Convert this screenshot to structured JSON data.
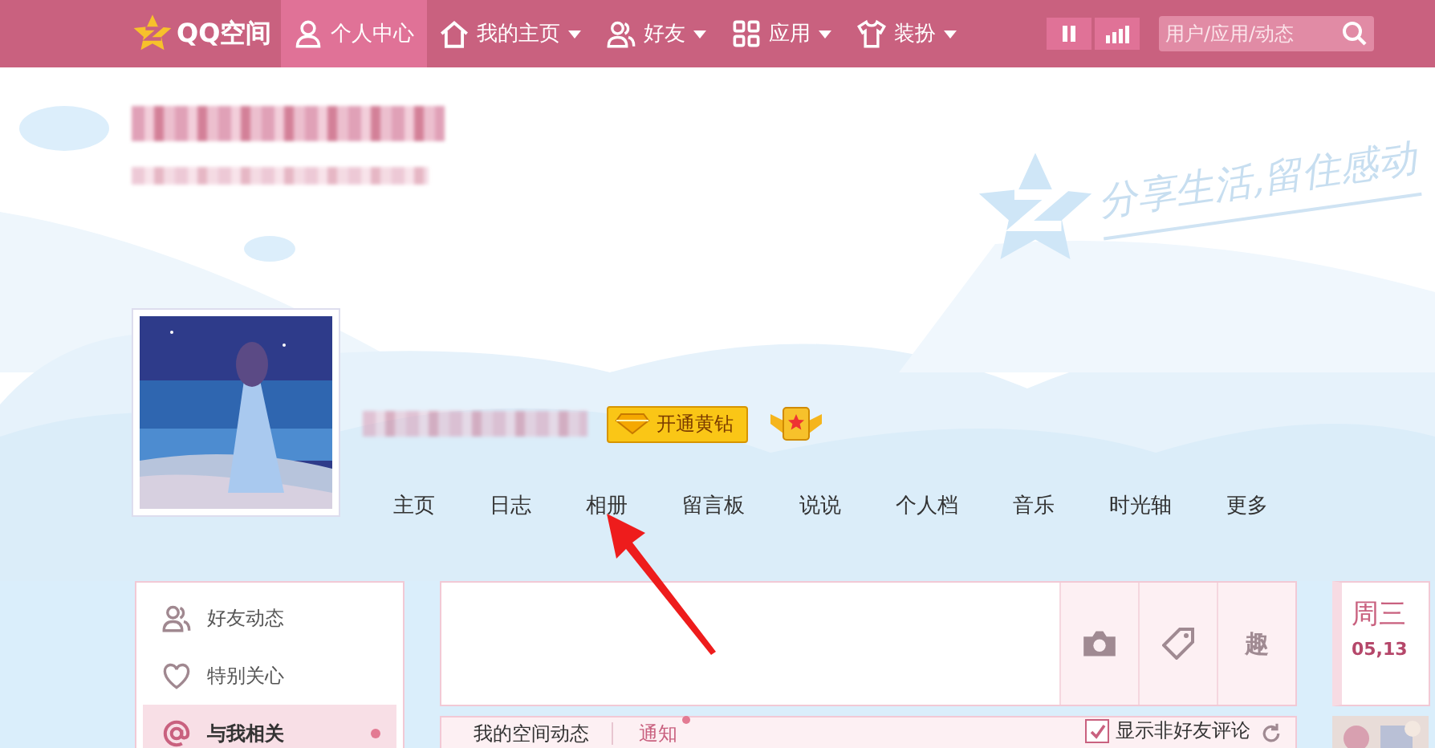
{
  "topbar": {
    "logo": "QQ空间",
    "nav": [
      {
        "label": "个人中心",
        "dropdown": false,
        "selected": true
      },
      {
        "label": "我的主页",
        "dropdown": true,
        "selected": false
      },
      {
        "label": "好友",
        "dropdown": true,
        "selected": false
      },
      {
        "label": "应用",
        "dropdown": true,
        "selected": false
      },
      {
        "label": "装扮",
        "dropdown": true,
        "selected": false
      }
    ],
    "search": {
      "placeholder": "用户/应用/动态"
    }
  },
  "header": {
    "slogan": "分享生活,留住感动",
    "vip_button": "开通黄钻",
    "tabs": [
      {
        "label": "主页"
      },
      {
        "label": "日志"
      },
      {
        "label": "相册"
      },
      {
        "label": "留言板"
      },
      {
        "label": "说说"
      },
      {
        "label": "个人档"
      },
      {
        "label": "音乐"
      },
      {
        "label": "时光轴"
      },
      {
        "label": "更多"
      }
    ]
  },
  "sidebar": {
    "items": [
      {
        "label": "好友动态",
        "selected": false,
        "dot": false
      },
      {
        "label": "特别关心",
        "selected": false,
        "dot": false
      },
      {
        "label": "与我相关",
        "selected": true,
        "dot": true
      }
    ]
  },
  "composer": {
    "tools": [
      {
        "kind": "camera"
      },
      {
        "kind": "tag"
      },
      {
        "kind": "text",
        "label": "趣"
      }
    ]
  },
  "feed_bar": {
    "tabs": [
      {
        "label": "我的空间动态",
        "dot": false
      },
      {
        "label": "通知",
        "dot": true
      }
    ],
    "option": {
      "label": "显示非好友评论",
      "checked": true
    }
  },
  "calendar": {
    "weekday": "周三",
    "date": "05,13"
  }
}
